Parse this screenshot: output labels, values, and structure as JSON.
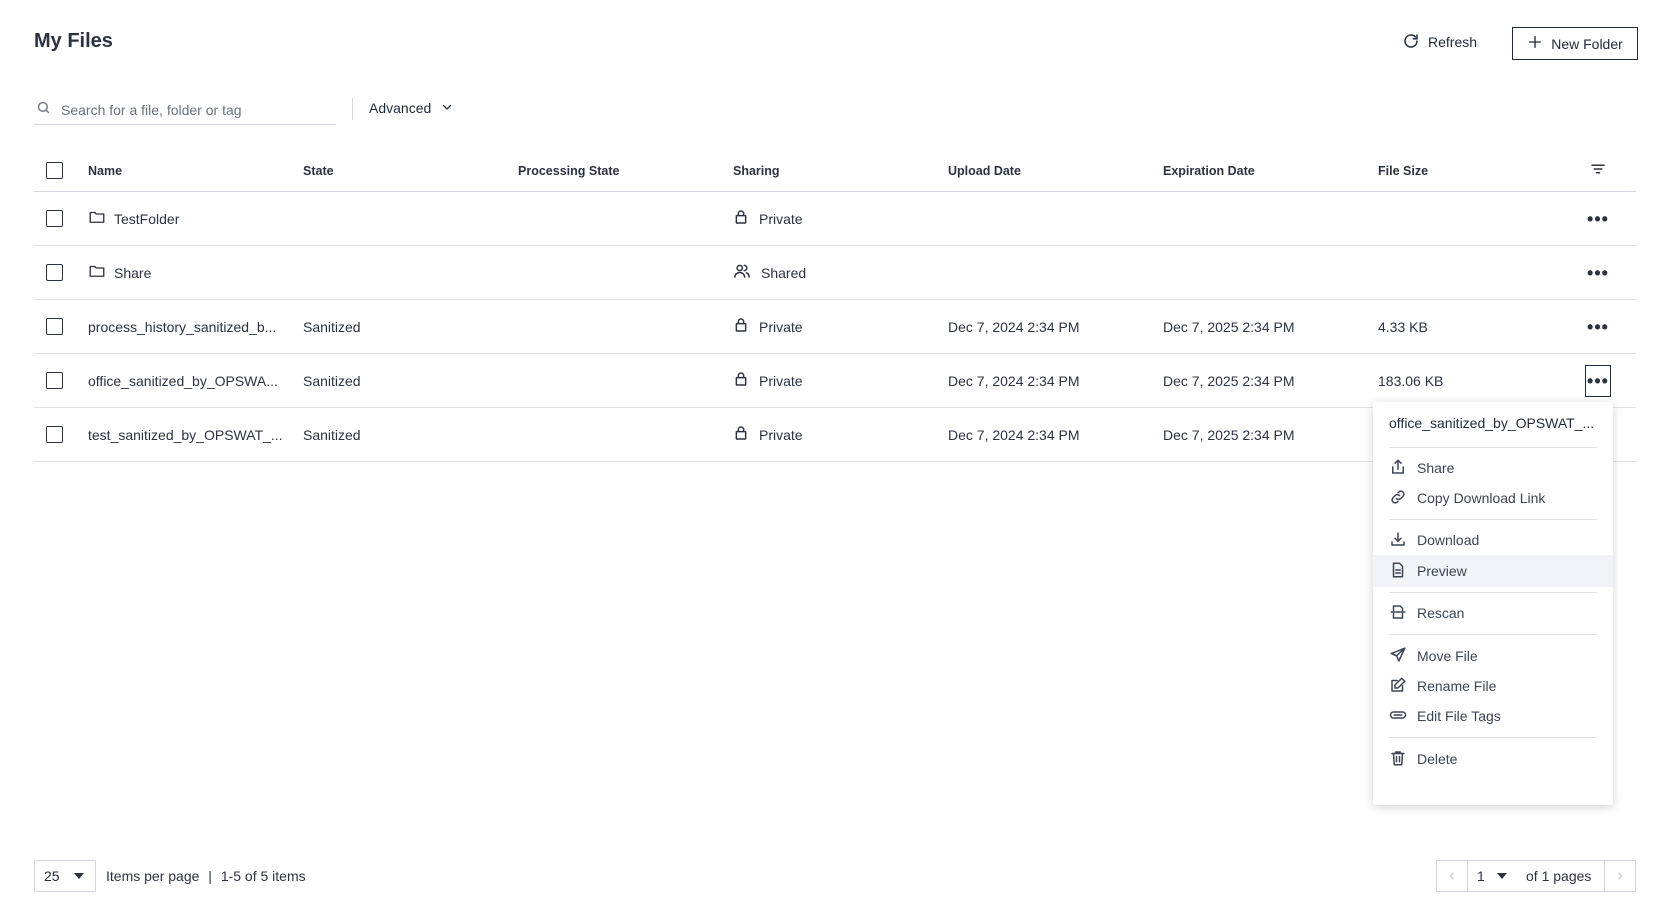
{
  "header": {
    "title": "My Files",
    "refresh_label": "Refresh",
    "new_folder_label": "New Folder"
  },
  "search": {
    "placeholder": "Search for a file, folder or tag",
    "value": "",
    "advanced_label": "Advanced"
  },
  "table": {
    "columns": {
      "name": "Name",
      "state": "State",
      "processing_state": "Processing State",
      "sharing": "Sharing",
      "upload_date": "Upload Date",
      "expiration_date": "Expiration Date",
      "file_size": "File Size"
    },
    "rows": [
      {
        "type": "folder",
        "icon": "folder-icon",
        "name": "TestFolder",
        "state": "",
        "processing_state": "",
        "sharing": "Private",
        "sharing_icon": "lock-icon",
        "upload_date": "",
        "expiration_date": "",
        "file_size": ""
      },
      {
        "type": "folder",
        "icon": "folder-icon",
        "name": "Share",
        "state": "",
        "processing_state": "",
        "sharing": "Shared",
        "sharing_icon": "users-icon",
        "upload_date": "",
        "expiration_date": "",
        "file_size": ""
      },
      {
        "type": "file",
        "name": "process_history_sanitized_b...",
        "state": "Sanitized",
        "processing_state": "",
        "sharing": "Private",
        "sharing_icon": "lock-icon",
        "upload_date": "Dec 7, 2024 2:34 PM",
        "expiration_date": "Dec 7, 2025 2:34 PM",
        "file_size": "4.33 KB"
      },
      {
        "type": "file",
        "name": "office_sanitized_by_OPSWA...",
        "state": "Sanitized",
        "processing_state": "",
        "sharing": "Private",
        "sharing_icon": "lock-icon",
        "upload_date": "Dec 7, 2024 2:34 PM",
        "expiration_date": "Dec 7, 2025 2:34 PM",
        "file_size": "183.06 KB"
      },
      {
        "type": "file",
        "name": "test_sanitized_by_OPSWAT_...",
        "state": "Sanitized",
        "processing_state": "",
        "sharing": "Private",
        "sharing_icon": "lock-icon",
        "upload_date": "Dec 7, 2024 2:34 PM",
        "expiration_date": "Dec 7, 2025 2:34 PM",
        "file_size": ""
      }
    ]
  },
  "context_menu": {
    "title": "office_sanitized_by_OPSWAT_...",
    "items": [
      {
        "label": "Share",
        "icon": "share-icon"
      },
      {
        "label": "Copy Download Link",
        "icon": "link-icon"
      },
      {
        "label": "Download",
        "icon": "download-icon"
      },
      {
        "label": "Preview",
        "icon": "document-icon",
        "hovered": true
      },
      {
        "label": "Rescan",
        "icon": "rescan-icon"
      },
      {
        "label": "Move File",
        "icon": "send-icon"
      },
      {
        "label": "Rename File",
        "icon": "edit-icon"
      },
      {
        "label": "Edit File Tags",
        "icon": "tag-icon"
      },
      {
        "label": "Delete",
        "icon": "trash-icon"
      }
    ]
  },
  "pagination": {
    "page_size": "25",
    "items_per_page_label": "Items per page",
    "separator": "|",
    "range_label": "1-5 of 5 items",
    "current_page": "1",
    "of_pages_label": "of 1 pages"
  },
  "colors": {
    "text": "#2b3342",
    "border": "#dfe3e8",
    "menu_hover": "#f1f3f6"
  }
}
